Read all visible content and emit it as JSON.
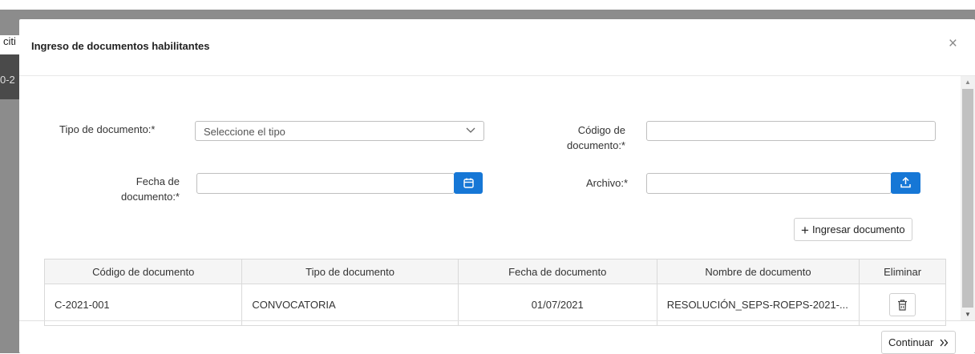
{
  "background": {
    "fragment_top": "citi",
    "fragment_bottom": "0-2"
  },
  "modal": {
    "title": "Ingreso de documentos habilitantes",
    "close_symbol": "×"
  },
  "form": {
    "tipo_label": "Tipo de documento:*",
    "tipo_placeholder": "Seleccione el tipo",
    "codigo_label_1": "Código de",
    "codigo_label_2": "documento:*",
    "codigo_value": "",
    "fecha_label_1": "Fecha de",
    "fecha_label_2": "documento:*",
    "fecha_value": "",
    "archivo_label": "Archivo:*",
    "archivo_value": "",
    "add_button": "Ingresar documento"
  },
  "table": {
    "headers": [
      "Código de documento",
      "Tipo de documento",
      "Fecha de documento",
      "Nombre de documento",
      "Eliminar"
    ],
    "rows": [
      {
        "codigo": "C-2021-001",
        "tipo": "CONVOCATORIA",
        "fecha": "01/07/2021",
        "nombre": "RESOLUCIÓN_SEPS-ROEPS-2021-..."
      }
    ]
  },
  "footer": {
    "continue_label": "Continuar"
  },
  "colors": {
    "primary": "#1677d6",
    "backdrop": "#8c8c8c"
  },
  "icons": [
    "close-icon",
    "chevron-down-icon",
    "calendar-icon",
    "upload-icon",
    "plus-icon",
    "trash-icon",
    "double-chevron-right-icon"
  ]
}
